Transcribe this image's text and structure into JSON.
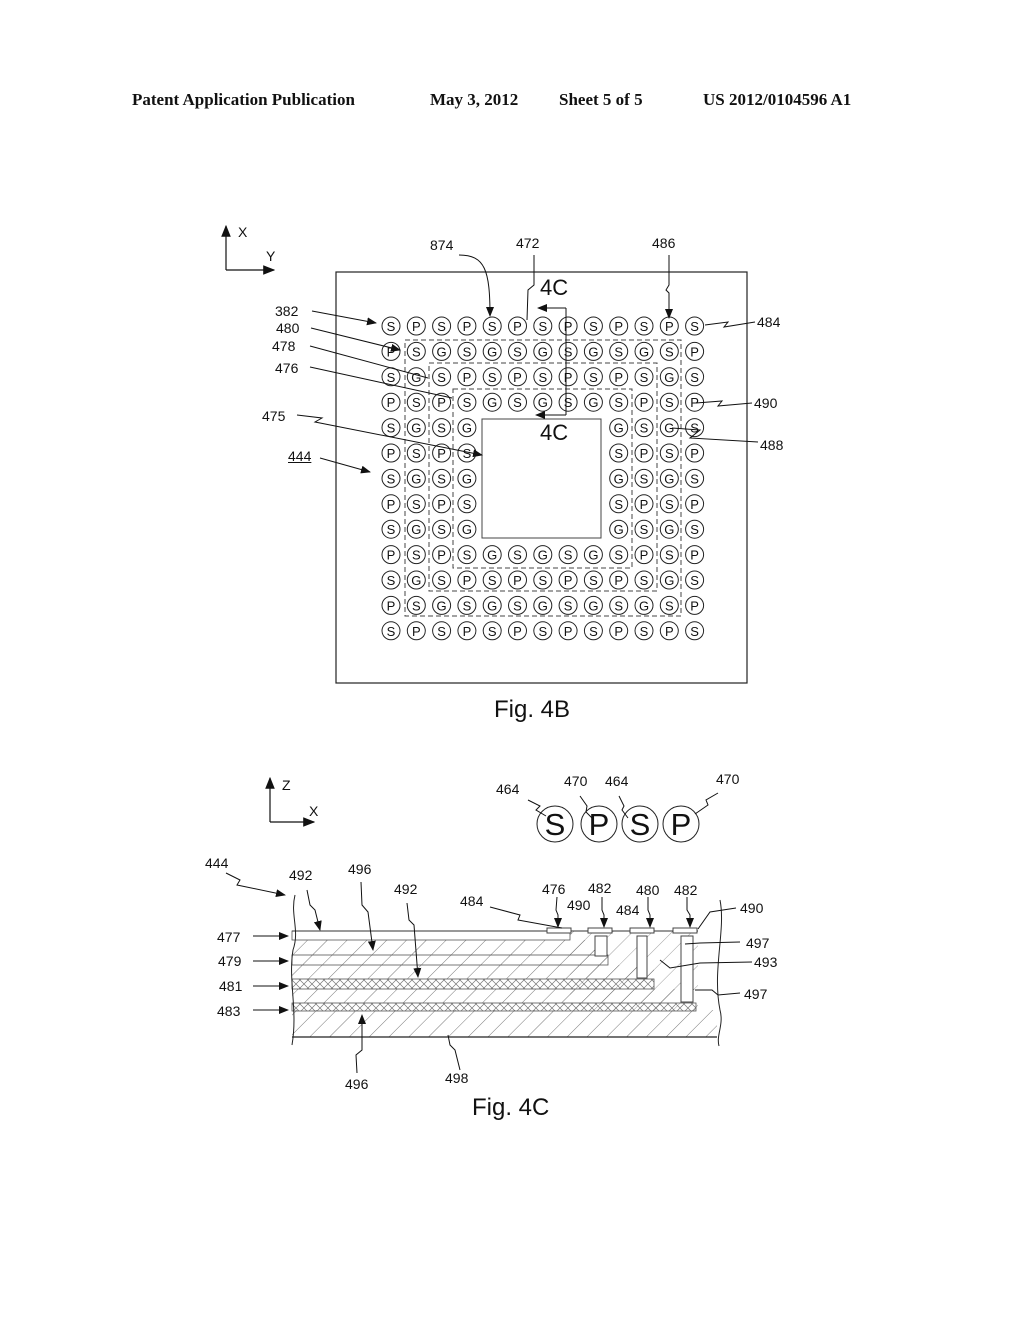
{
  "header": {
    "publication": "Patent Application Publication",
    "date": "May 3, 2012",
    "sheet": "Sheet 5 of 5",
    "number": "US 2012/0104596 A1"
  },
  "fig4b": {
    "caption": "Fig. 4B",
    "axis": {
      "up": "X",
      "right": "Y"
    },
    "section_label": "4C",
    "section_label_bottom": "4C",
    "labels": {
      "l874": "874",
      "l472": "472",
      "l486": "486",
      "l484": "484",
      "l382": "382",
      "l480": "480",
      "l478": "478",
      "l476": "476",
      "l475": "475",
      "l444": "444",
      "l490": "490",
      "l488": "488"
    },
    "grid": [
      [
        "S",
        "P",
        "S",
        "P",
        "S",
        "P",
        "S",
        "P",
        "S",
        "P",
        "S",
        "P",
        "S"
      ],
      [
        "P",
        "S",
        "G",
        "S",
        "G",
        "S",
        "G",
        "S",
        "G",
        "S",
        "G",
        "S",
        "P"
      ],
      [
        "S",
        "G",
        "S",
        "P",
        "S",
        "P",
        "S",
        "P",
        "S",
        "P",
        "S",
        "G",
        "S"
      ],
      [
        "P",
        "S",
        "P",
        "S",
        "G",
        "S",
        "G",
        "S",
        "G",
        "S",
        "P",
        "S",
        "P"
      ],
      [
        "S",
        "G",
        "S",
        "G",
        "",
        "",
        "",
        "",
        "",
        "G",
        "S",
        "G",
        "S"
      ],
      [
        "P",
        "S",
        "P",
        "S",
        "",
        "",
        "",
        "",
        "",
        "S",
        "P",
        "S",
        "P"
      ],
      [
        "S",
        "G",
        "S",
        "G",
        "",
        "",
        "",
        "",
        "",
        "G",
        "S",
        "G",
        "S"
      ],
      [
        "P",
        "S",
        "P",
        "S",
        "",
        "",
        "",
        "",
        "",
        "S",
        "P",
        "S",
        "P"
      ],
      [
        "S",
        "G",
        "S",
        "G",
        "",
        "",
        "",
        "",
        "",
        "G",
        "S",
        "G",
        "S"
      ],
      [
        "P",
        "S",
        "P",
        "S",
        "G",
        "S",
        "G",
        "S",
        "G",
        "S",
        "P",
        "S",
        "P"
      ],
      [
        "S",
        "G",
        "S",
        "P",
        "S",
        "P",
        "S",
        "P",
        "S",
        "P",
        "S",
        "G",
        "S"
      ],
      [
        "P",
        "S",
        "G",
        "S",
        "G",
        "S",
        "G",
        "S",
        "G",
        "S",
        "G",
        "S",
        "P"
      ],
      [
        "S",
        "P",
        "S",
        "P",
        "S",
        "P",
        "S",
        "P",
        "S",
        "P",
        "S",
        "P",
        "S"
      ]
    ]
  },
  "fig4c": {
    "caption": "Fig. 4C",
    "axis": {
      "up": "Z",
      "right": "X"
    },
    "legend": [
      {
        "letter": "S",
        "ref": "464"
      },
      {
        "letter": "P",
        "ref": "470"
      },
      {
        "letter": "S",
        "ref": "464"
      },
      {
        "letter": "P",
        "ref": "470"
      }
    ],
    "labels": {
      "l444": "444",
      "l492a": "492",
      "l496a": "496",
      "l492b": "492",
      "l484a": "484",
      "l476": "476",
      "l482a": "482",
      "l490a": "490",
      "l480": "480",
      "l484b": "484",
      "l482b": "482",
      "l490b": "490",
      "l497a": "497",
      "l493": "493",
      "l497b": "497",
      "l477": "477",
      "l479": "479",
      "l481": "481",
      "l483": "483",
      "l496b": "496",
      "l498": "498"
    }
  }
}
